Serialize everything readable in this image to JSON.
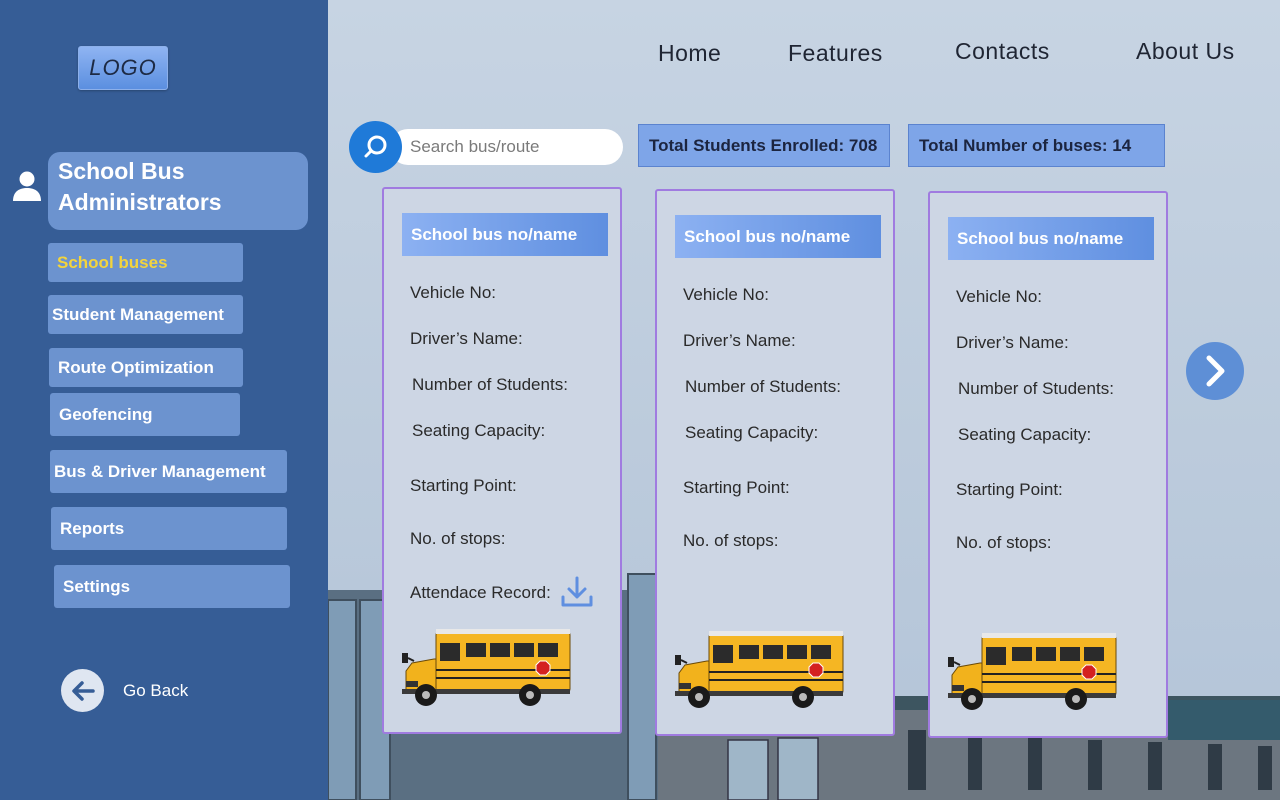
{
  "brand": {
    "logo_text": "LOGO"
  },
  "sidebar": {
    "title": "School Bus Administrators",
    "items": [
      {
        "label": "School buses",
        "active": true
      },
      {
        "label": "Student Management"
      },
      {
        "label": "Route Optimization"
      },
      {
        "label": "Geofencing"
      },
      {
        "label": "Bus & Driver Management"
      },
      {
        "label": "Reports"
      },
      {
        "label": "Settings"
      }
    ],
    "back_label": "Go Back"
  },
  "nav": {
    "items": [
      "Home",
      "Features",
      "Contacts",
      "About Us"
    ]
  },
  "search": {
    "placeholder": "Search bus/route"
  },
  "stats": {
    "students": "Total Students Enrolled: 708",
    "buses": "Total Number of buses: 14"
  },
  "cards": [
    {
      "title": "School bus no/name",
      "fields": [
        "Vehicle No:",
        "Driver’s Name:",
        "Number of Students:",
        "Seating Capacity:",
        "Starting Point:",
        "No. of stops:"
      ],
      "attendance_label": "Attendace Record:"
    },
    {
      "title": "School bus no/name",
      "fields": [
        "Vehicle No:",
        "Driver’s Name:",
        "Number of Students:",
        "Seating Capacity:",
        "Starting Point:",
        "No. of stops:"
      ]
    },
    {
      "title": "School bus no/name",
      "fields": [
        "Vehicle No:",
        "Driver’s Name:",
        "Number of Students:",
        "Seating Capacity:",
        "Starting Point:",
        "No. of stops:"
      ]
    }
  ],
  "colors": {
    "sidebar_bg": "#365d96",
    "nav_item_bg": "#6c93cf",
    "active_text": "#f3d43c",
    "search_button": "#1f7ad8",
    "card_border": "#a07be0"
  },
  "icons": [
    "user-icon",
    "search-icon",
    "download-icon",
    "arrow-left-icon",
    "chevron-right-icon",
    "school-bus-image"
  ]
}
